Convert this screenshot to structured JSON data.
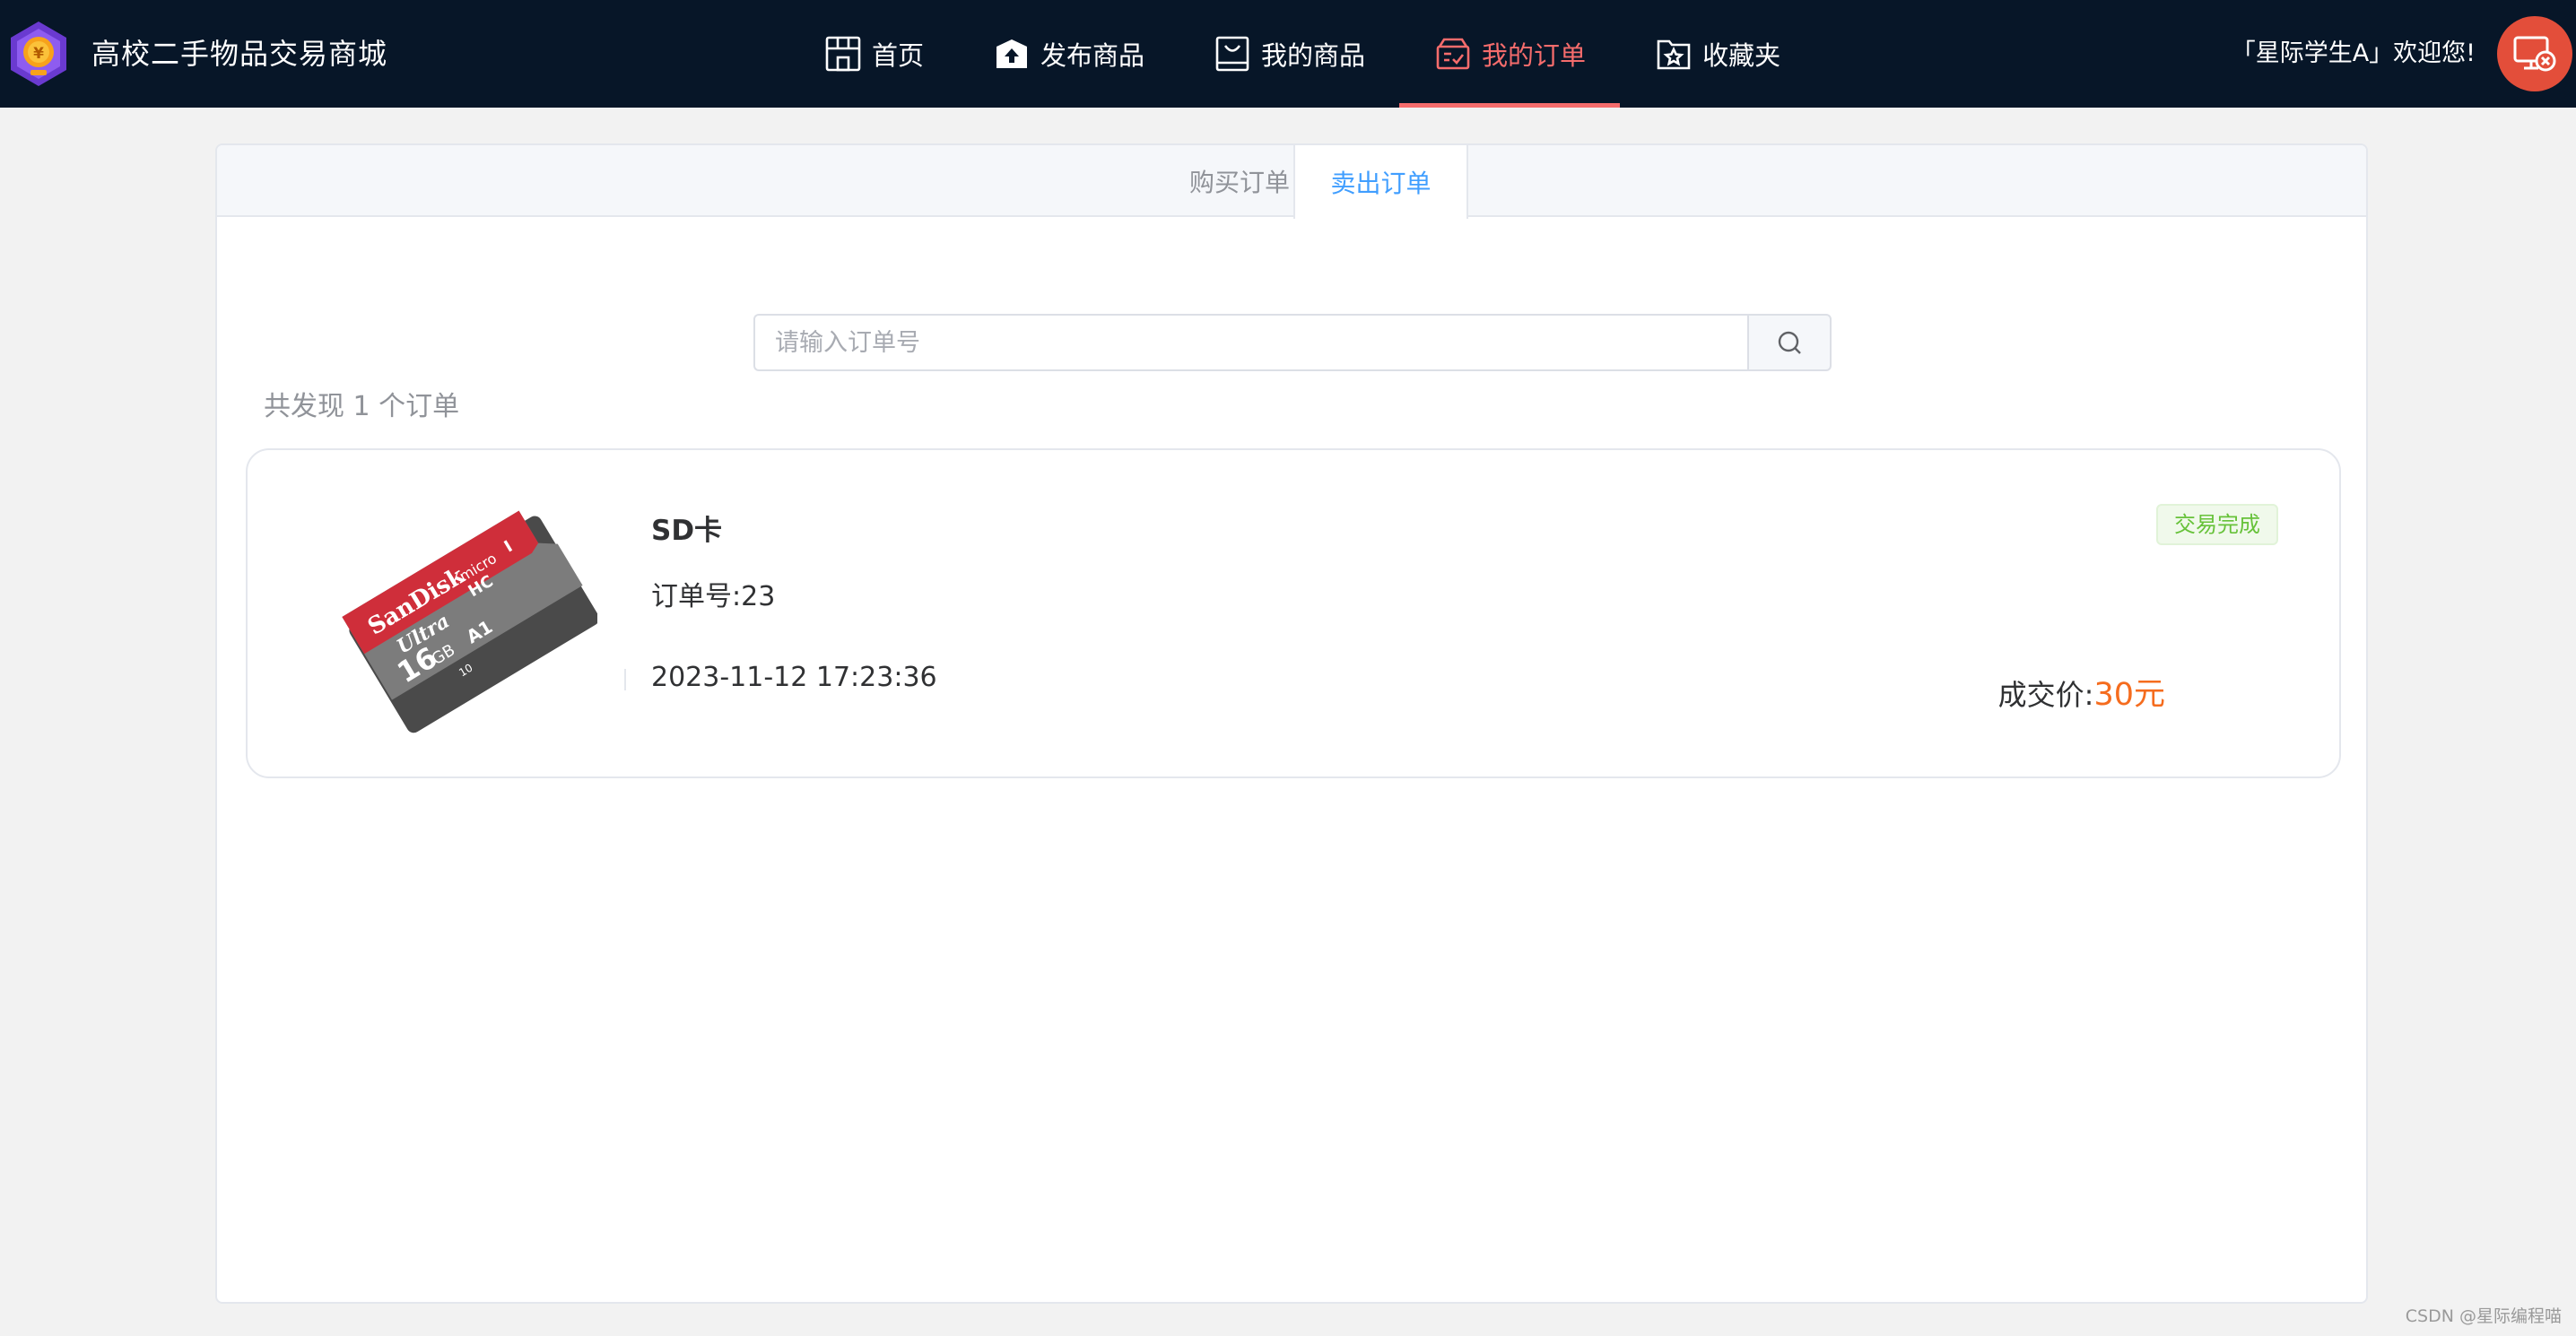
{
  "header": {
    "brand": "高校二手物品交易商城",
    "welcome": "「星际学生A」欢迎您!",
    "nav": [
      {
        "label": "首页",
        "icon": "storefront-icon"
      },
      {
        "label": "发布商品",
        "icon": "upload-box-icon"
      },
      {
        "label": "我的商品",
        "icon": "shopping-bag-icon"
      },
      {
        "label": "我的订单",
        "icon": "order-box-icon",
        "active": true
      },
      {
        "label": "收藏夹",
        "icon": "star-folder-icon"
      }
    ],
    "colors": {
      "bg": "#071628",
      "active": "#f56c6c",
      "avatar": "#e34e3a"
    }
  },
  "tabs": {
    "buy": "购买订单",
    "sell": "卖出订单",
    "active": "sell"
  },
  "search": {
    "placeholder": "请输入订单号",
    "value": ""
  },
  "result_count": "共发现 1 个订单",
  "orders": [
    {
      "name": "SD卡",
      "order_no": "订单号:23",
      "time": "2023-11-12 17:23:36",
      "status": "交易完成",
      "price_label": "成交价:",
      "price": "30元",
      "image": {
        "brand": "SanDisk",
        "line": "Ultra",
        "capacity": "16",
        "unit": "GB",
        "format": "micro",
        "class": "HC",
        "speed": "I",
        "a_class": "A1",
        "grade": "10"
      }
    }
  ],
  "watermark": "CSDN @星际编程喵"
}
